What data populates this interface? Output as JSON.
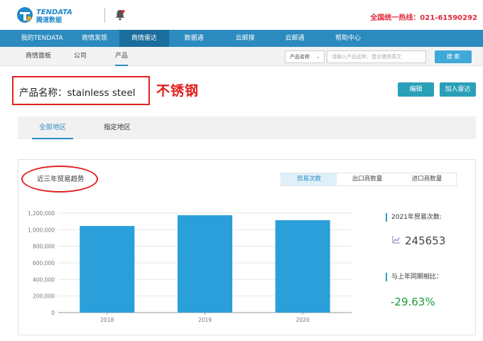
{
  "header": {
    "logo_text": "TENDATA",
    "logo_subtext": "腾道数据",
    "hotline": "全国统一热线：021-61590292"
  },
  "main_nav": [
    {
      "label": "我的TENDATA"
    },
    {
      "label": "商情发现"
    },
    {
      "label": "商情雷达"
    },
    {
      "label": "数据通"
    },
    {
      "label": "云邮搜"
    },
    {
      "label": "云邮通"
    },
    {
      "label": "帮助中心"
    }
  ],
  "main_nav_active": "商情雷达",
  "sub_nav": [
    {
      "label": "商情面板"
    },
    {
      "label": "公司"
    },
    {
      "label": "产品"
    }
  ],
  "search": {
    "select_value": "产品名称",
    "placeholder": "请输入产品名称，建议使用英文",
    "button_label": "搜 索"
  },
  "product": {
    "title": "产品名称：stainless steel",
    "annotation": "不锈钢"
  },
  "actions": {
    "edit_label": "编辑",
    "add_radar_label": "加入雷达"
  },
  "region_tabs": [
    {
      "label": "全部地区"
    },
    {
      "label": "指定地区"
    }
  ],
  "trend": {
    "title": "近三年贸易趋势"
  },
  "metric_tabs": [
    {
      "label": "贸易次数"
    },
    {
      "label": "出口商数量"
    },
    {
      "label": "进口商数量"
    }
  ],
  "stats": {
    "count_label": "2021年贸易次数:",
    "count_value": "245653",
    "yoy_label": "与上年同期相比：",
    "yoy_value": "-29.63%"
  },
  "colors": {
    "nav_blue": "#2b8bbf",
    "bar_blue": "#2b9fd9",
    "accent_red": "#e32020",
    "positive_green": "#1a9a3c",
    "button_teal": "#2aa0b8"
  },
  "chart_data": {
    "type": "bar",
    "categories": [
      "2018",
      "2019",
      "2020"
    ],
    "values": [
      1045000,
      1175000,
      1115000
    ],
    "ylim": [
      0,
      1200000
    ],
    "yticks": [
      "0",
      "200,000",
      "400,000",
      "600,000",
      "800,000",
      "1,000,000",
      "1,200,000"
    ],
    "ytick_values": [
      0,
      200000,
      400000,
      600000,
      800000,
      1000000,
      1200000
    ],
    "grid": true,
    "title": "",
    "xlabel": "",
    "ylabel": ""
  }
}
